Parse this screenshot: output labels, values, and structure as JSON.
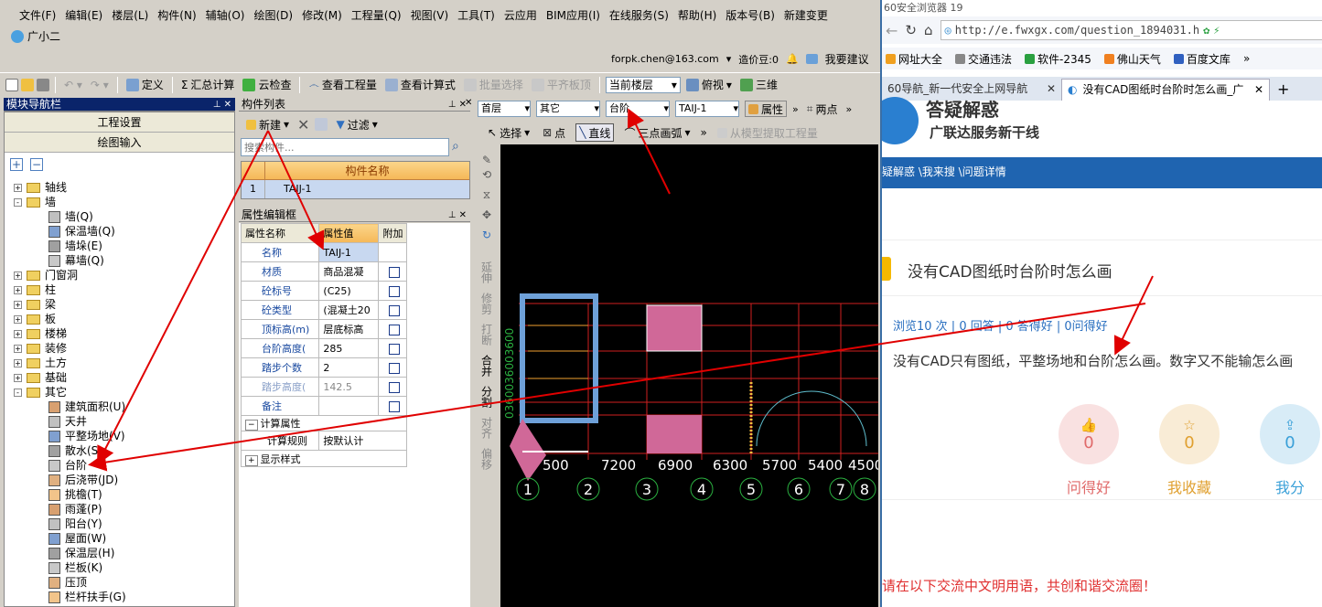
{
  "app": {
    "menus": [
      "文件(F)",
      "编辑(E)",
      "楼层(L)",
      "构件(N)",
      "辅轴(O)",
      "绘图(D)",
      "修改(M)",
      "工程量(Q)",
      "视图(V)",
      "工具(T)",
      "云应用",
      "BIM应用(I)",
      "在线服务(S)",
      "帮助(H)",
      "版本号(B)",
      "新建变更"
    ],
    "assistant": "广小二",
    "user_email": "forpk.chen@163.com",
    "price_beans": "造价豆:0",
    "suggest": "我要建议",
    "toolbar": {
      "define": "定义",
      "summary": "汇总计算",
      "cloud_check": "云检查",
      "view_qty": "查看工程量",
      "view_formula": "查看计算式",
      "batch_select": "批量选择",
      "align_slab": "平齐板顶",
      "current_floor": "当前楼层",
      "view_mode": "俯视",
      "three_d": "三维"
    },
    "nav": {
      "title": "模块导航栏",
      "btn_project": "工程设置",
      "btn_draw": "绘图输入",
      "tree": [
        {
          "label": "轴线",
          "level": 0,
          "type": "folder",
          "exp": "+"
        },
        {
          "label": "墙",
          "level": 0,
          "type": "folder",
          "exp": "-"
        },
        {
          "label": "墙(Q)",
          "level": 1
        },
        {
          "label": "保温墙(Q)",
          "level": 1
        },
        {
          "label": "墙垛(E)",
          "level": 1
        },
        {
          "label": "幕墙(Q)",
          "level": 1
        },
        {
          "label": "门窗洞",
          "level": 0,
          "type": "folder",
          "exp": "+"
        },
        {
          "label": "柱",
          "level": 0,
          "type": "folder",
          "exp": "+"
        },
        {
          "label": "梁",
          "level": 0,
          "type": "folder",
          "exp": "+"
        },
        {
          "label": "板",
          "level": 0,
          "type": "folder",
          "exp": "+"
        },
        {
          "label": "楼梯",
          "level": 0,
          "type": "folder",
          "exp": "+"
        },
        {
          "label": "装修",
          "level": 0,
          "type": "folder",
          "exp": "+"
        },
        {
          "label": "土方",
          "level": 0,
          "type": "folder",
          "exp": "+"
        },
        {
          "label": "基础",
          "level": 0,
          "type": "folder",
          "exp": "+"
        },
        {
          "label": "其它",
          "level": 0,
          "type": "folder",
          "exp": "-"
        },
        {
          "label": "建筑面积(U)",
          "level": 1
        },
        {
          "label": "天井",
          "level": 1
        },
        {
          "label": "平整场地(V)",
          "level": 1
        },
        {
          "label": "散水(S)",
          "level": 1
        },
        {
          "label": "台阶",
          "level": 1
        },
        {
          "label": "后浇带(JD)",
          "level": 1
        },
        {
          "label": "挑檐(T)",
          "level": 1
        },
        {
          "label": "雨蓬(P)",
          "level": 1
        },
        {
          "label": "阳台(Y)",
          "level": 1
        },
        {
          "label": "屋面(W)",
          "level": 1
        },
        {
          "label": "保温层(H)",
          "level": 1
        },
        {
          "label": "栏板(K)",
          "level": 1
        },
        {
          "label": "压顶",
          "level": 1
        },
        {
          "label": "栏杆扶手(G)",
          "level": 1
        }
      ]
    },
    "component_list": {
      "title": "构件列表",
      "new": "新建",
      "filter": "过滤",
      "search_placeholder": "搜索构件...",
      "col_name": "构件名称",
      "rows": [
        {
          "no": "1",
          "name": "TAIJ-1"
        }
      ]
    },
    "property_editor": {
      "title": "属性编辑框",
      "col_name": "属性名称",
      "col_value": "属性值",
      "col_attach": "附加",
      "rows": [
        {
          "name": "名称",
          "value": "TAIJ-1",
          "check": false
        },
        {
          "name": "材质",
          "value": "商品混凝",
          "check": true
        },
        {
          "name": "砼标号",
          "value": "(C25)",
          "check": true
        },
        {
          "name": "砼类型",
          "value": "(混凝土20",
          "check": true
        },
        {
          "name": "顶标高(m)",
          "value": "层底标高",
          "check": true
        },
        {
          "name": "台阶高度(",
          "value": "285",
          "check": true
        },
        {
          "name": "踏步个数",
          "value": "2",
          "check": true
        },
        {
          "name": "踏步高度(",
          "value": "142.5",
          "check": true,
          "gray": true
        },
        {
          "name": "备注",
          "value": "",
          "check": true
        }
      ],
      "group_calc": "计算属性",
      "calc_rule_label": "计算规则",
      "calc_rule_value": "按默认计",
      "group_display": "显示样式"
    },
    "draw_toolbar": {
      "floor": "首层",
      "category": "其它",
      "component": "台阶",
      "instance": "TAIJ-1",
      "property": "属性",
      "two_points": "两点",
      "select": "选择",
      "point": "点",
      "line": "直线",
      "arc": "三点画弧",
      "extract": "从模型提取工程量"
    },
    "vtools": [
      "延伸",
      "修剪",
      "打断",
      "合并",
      "分割",
      "对齐",
      "偏移"
    ],
    "cad": {
      "axis_dims": [
        "500",
        "7200",
        "6900",
        "6300",
        "5700",
        "5400",
        "4500"
      ],
      "axis_nums": [
        "1",
        "2",
        "3",
        "4",
        "5",
        "6",
        "7",
        "8"
      ],
      "vertical_text": "0360036003600"
    }
  },
  "browser": {
    "title_text": "60安全浏览器 19",
    "url": "http://e.fwxgx.com/question_1894031.h",
    "bookmarks": [
      "网址大全",
      "交通违法",
      "软件-2345",
      "佛山天气",
      "百度文库"
    ],
    "tabs": [
      {
        "label": "60导航_新一代安全上网导航",
        "active": false
      },
      {
        "label": "没有CAD图纸时台阶时怎么画_广",
        "active": true
      }
    ],
    "site_slogan": "广联达服务新干线",
    "site_logo_partial": "答疑解惑",
    "breadcrumb": "疑解惑 \\我来搜 \\问题详情",
    "question_title": "没有CAD图纸时台阶时怎么画",
    "meta": "浏览10 次 | 0 回答 | 0 答得好 | 0问得好",
    "body": "没有CAD只有图纸，平整场地和台阶怎么画。数字又不能输怎么画",
    "stats": [
      {
        "count": "0",
        "label": "问得好",
        "color": "#e06a6a"
      },
      {
        "count": "0",
        "label": "我收藏",
        "color": "#e0a030"
      },
      {
        "count": "0",
        "label": "我分",
        "color": "#3aa0d8"
      }
    ],
    "footer_notice": "请在以下交流中文明用语，共创和谐交流圈！"
  }
}
